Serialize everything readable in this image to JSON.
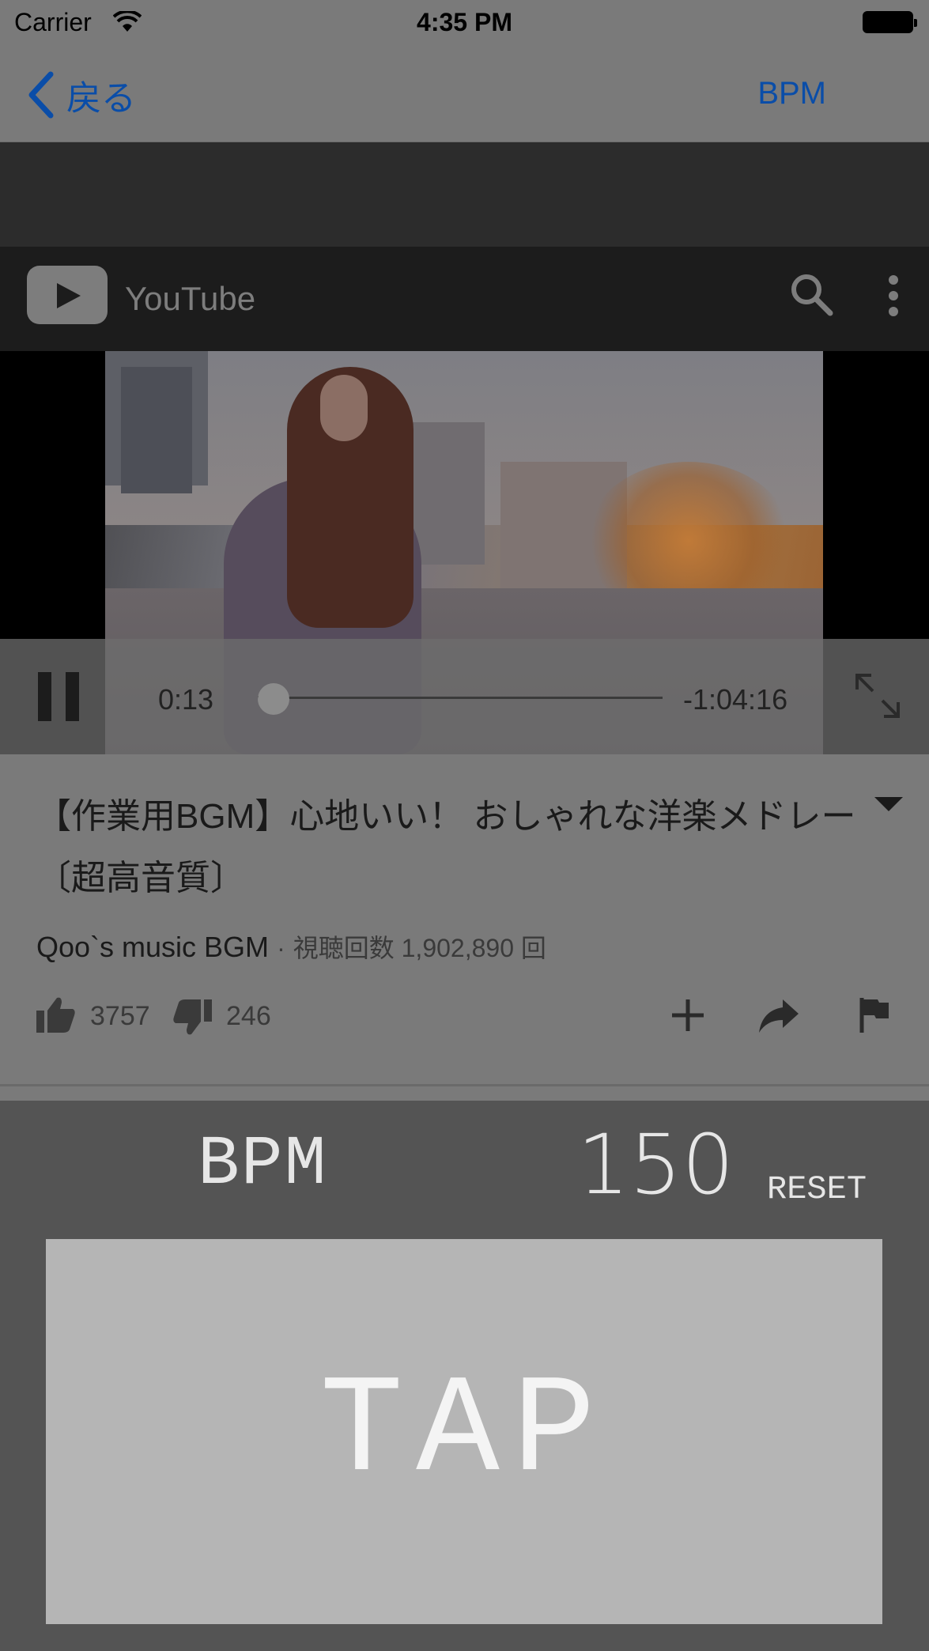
{
  "status_bar": {
    "carrier": "Carrier",
    "time": "4:35 PM"
  },
  "nav": {
    "back_label": "戻る",
    "right_label": "BPM"
  },
  "youtube": {
    "title": "YouTube"
  },
  "player": {
    "current_time": "0:13",
    "remaining_time": "-1:04:16",
    "progress": 0.05
  },
  "video": {
    "title": "【作業用BGM】心地いい！ おしゃれな洋楽メドレー〔超高音質〕",
    "channel": "Qoo`s music BGM",
    "separator": "·",
    "views": "視聴回数 1,902,890 回",
    "likes": "3757",
    "dislikes": "246"
  },
  "bpm_panel": {
    "label": "BPM",
    "value": "150",
    "reset_label": "RESET",
    "tap_label": "TAP"
  },
  "colors": {
    "link_blue": "#0a4da8",
    "panel_bg": "#545454",
    "tap_bg": "#b5b5b5"
  }
}
